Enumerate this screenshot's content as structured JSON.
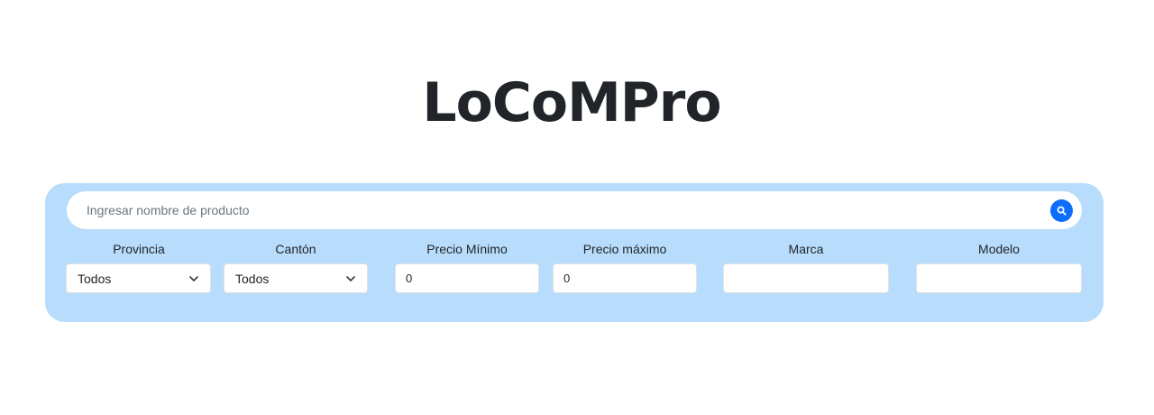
{
  "header": {
    "title": "LoCoMPro"
  },
  "search": {
    "placeholder": "Ingresar nombre de producto",
    "value": "",
    "button_icon": "search-icon",
    "button_color": "#0d6efd"
  },
  "panel": {
    "background": "#b8dcfb"
  },
  "filters": {
    "provincia": {
      "label": "Provincia",
      "selected": "Todos"
    },
    "canton": {
      "label": "Cantón",
      "selected": "Todos"
    },
    "precio_minimo": {
      "label": "Precio Mínimo",
      "value": "0"
    },
    "precio_maximo": {
      "label": "Precio máximo",
      "value": "0"
    },
    "marca": {
      "label": "Marca",
      "value": ""
    },
    "modelo": {
      "label": "Modelo",
      "value": ""
    }
  }
}
